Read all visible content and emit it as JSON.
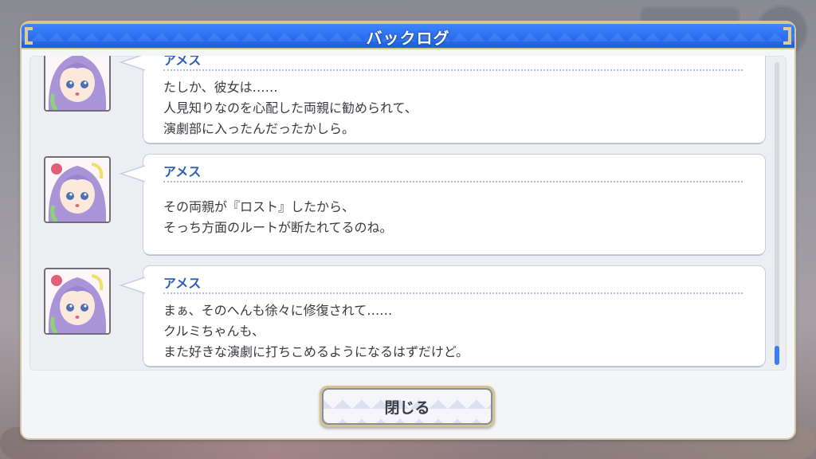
{
  "title": "バックログ",
  "entries": [
    {
      "speaker": "アメス",
      "lines": [
        "たしか、彼女は……",
        "人見知りなのを心配した両親に勧められて、",
        "演劇部に入ったんだったかしら。"
      ]
    },
    {
      "speaker": "アメス",
      "lines": [
        "その両親が『ロスト』したから、",
        "そっち方面のルートが断たれてるのね。"
      ]
    },
    {
      "speaker": "アメス",
      "lines": [
        "まぁ、そのへんも徐々に修復されて……",
        "クルミちゃんも、",
        "また好きな演劇に打ちこめるようになるはずだけど。"
      ]
    }
  ],
  "close_label": "閉じる",
  "colors": {
    "title_bar": "#2b6ff0",
    "speaker": "#2e5eb8",
    "scroll_thumb": "#3b7df2",
    "frame_gold": "#d4c48f"
  }
}
